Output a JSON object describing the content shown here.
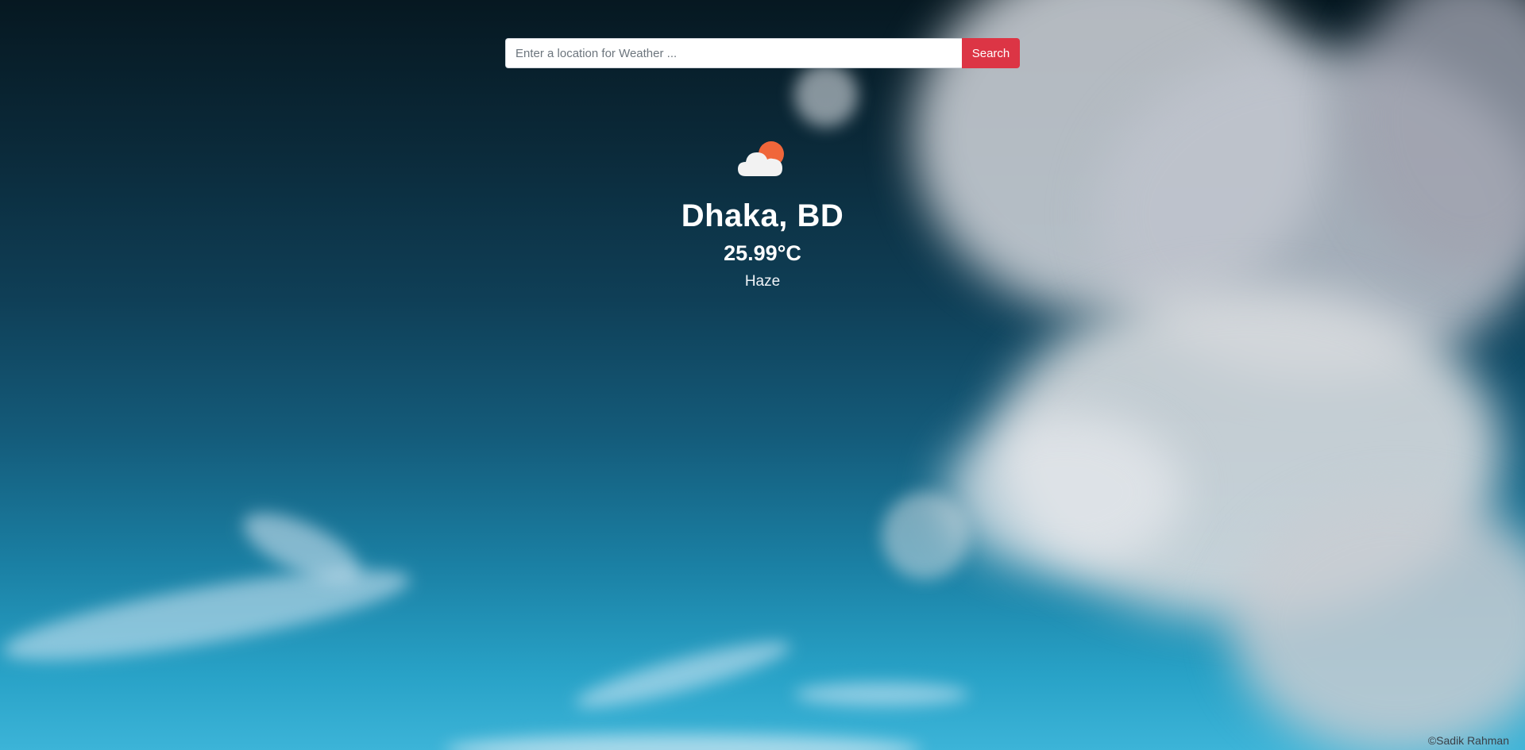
{
  "search": {
    "placeholder": "Enter a location for Weather ...",
    "value": "",
    "button_label": "Search"
  },
  "weather": {
    "icon": "partly-cloudy-icon",
    "location": "Dhaka, BD",
    "temperature": "25.99°C",
    "condition": "Haze"
  },
  "footer": {
    "credit": "©Sadik Rahman"
  },
  "colors": {
    "search_button": "#dc3545",
    "sun": "#f0663a",
    "cloud": "#f2f2f2"
  }
}
